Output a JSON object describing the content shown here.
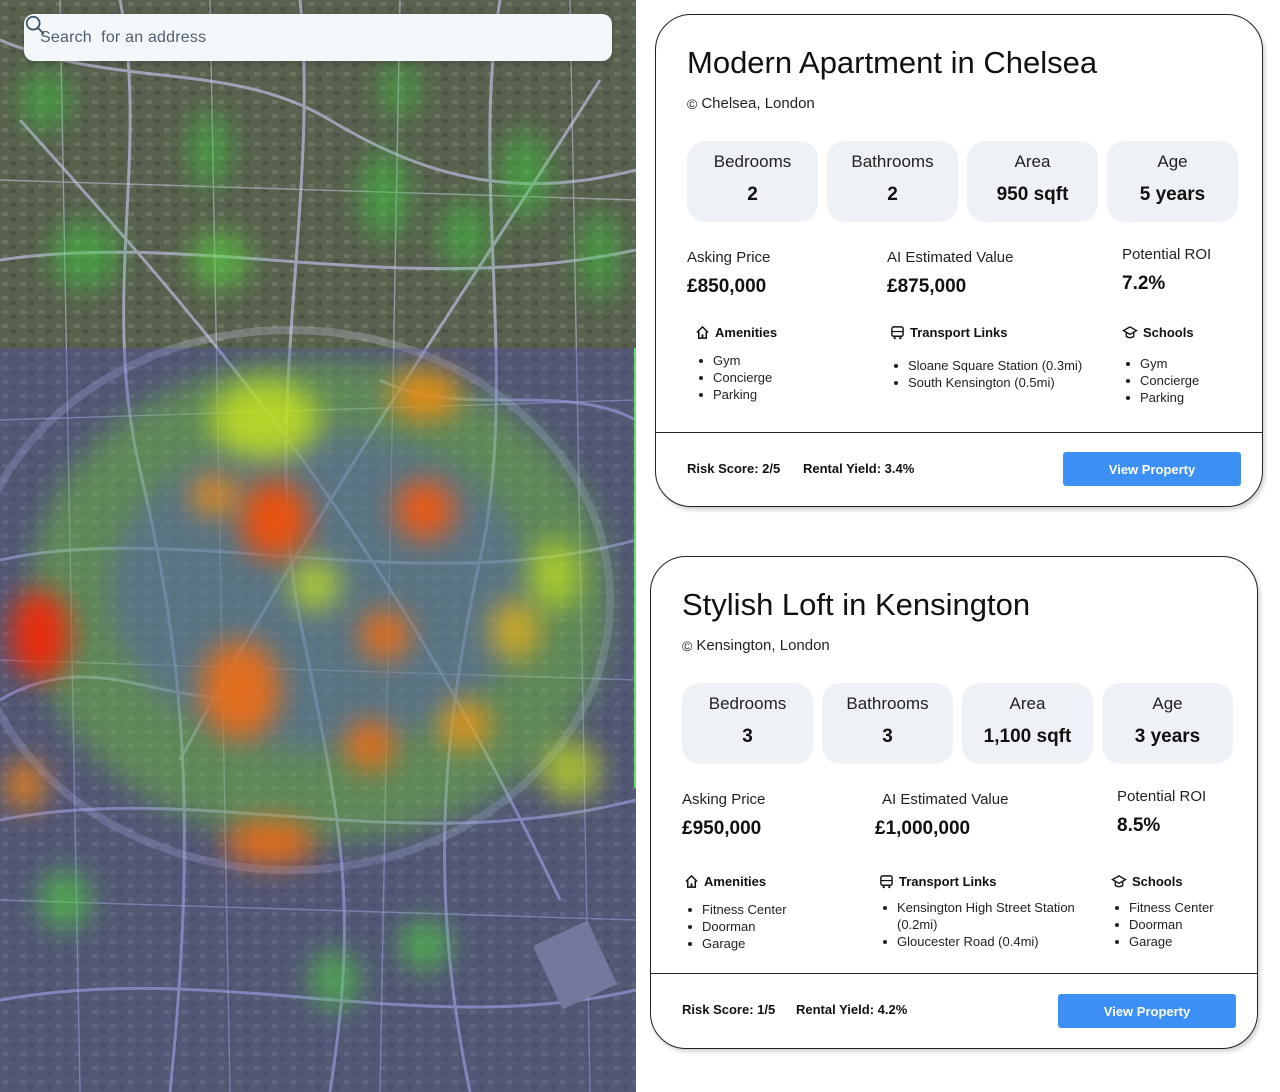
{
  "search": {
    "placeholder": "Search  for an address",
    "icon": "search-icon"
  },
  "colors": {
    "accent": "#3b8ff5",
    "card_bg": "#ffffff",
    "stat_bg": "#eef2f7"
  },
  "properties": [
    {
      "title": "Modern Apartment in Chelsea",
      "location": "Chelsea, London",
      "stats": [
        {
          "label": "Bedrooms",
          "value": "2"
        },
        {
          "label": "Bathrooms",
          "value": "2"
        },
        {
          "label": "Area",
          "value": "950 sqft"
        },
        {
          "label": "Age",
          "value": "5 years"
        }
      ],
      "asking_label": "Asking Price",
      "asking_value": "£850,000",
      "estimate_label": "AI Estimated Value",
      "estimate_value": "£875,000",
      "roi_label": "Potential ROI",
      "roi_value": "7.2%",
      "amenities_label": "Amenities",
      "amenities": [
        "Gym",
        "Concierge",
        "Parking"
      ],
      "transport_label": "Transport Links",
      "transport": [
        "Sloane Square Station (0.3mi)",
        "South Kensington (0.5mi)"
      ],
      "schools_label": "Schools",
      "schools": [
        "Gym",
        "Concierge",
        "Parking"
      ],
      "risk": "Risk Score: 2/5",
      "yield": "Rental Yield: 3.4%",
      "button": "View Property"
    },
    {
      "title": "Stylish Loft in Kensington",
      "location": "Kensington, London",
      "stats": [
        {
          "label": "Bedrooms",
          "value": "3"
        },
        {
          "label": "Bathrooms",
          "value": "3"
        },
        {
          "label": "Area",
          "value": "1,100 sqft"
        },
        {
          "label": "Age",
          "value": "3 years"
        }
      ],
      "asking_label": "Asking Price",
      "asking_value": "£950,000",
      "estimate_label": "AI Estimated Value",
      "estimate_value": "£1,000,000",
      "roi_label": "Potential ROI",
      "roi_value": "8.5%",
      "amenities_label": "Amenities",
      "amenities": [
        "Fitness Center",
        "Doorman",
        "Garage"
      ],
      "transport_label": "Transport Links",
      "transport": [
        "Kensington High Street Station (0.2mi)",
        "Gloucester Road (0.4mi)"
      ],
      "schools_label": "Schools",
      "schools": [
        "Fitness Center",
        "Doorman",
        "Garage"
      ],
      "risk": "Risk Score: 1/5",
      "yield": "Rental Yield: 4.2%",
      "button": "View Property"
    }
  ]
}
